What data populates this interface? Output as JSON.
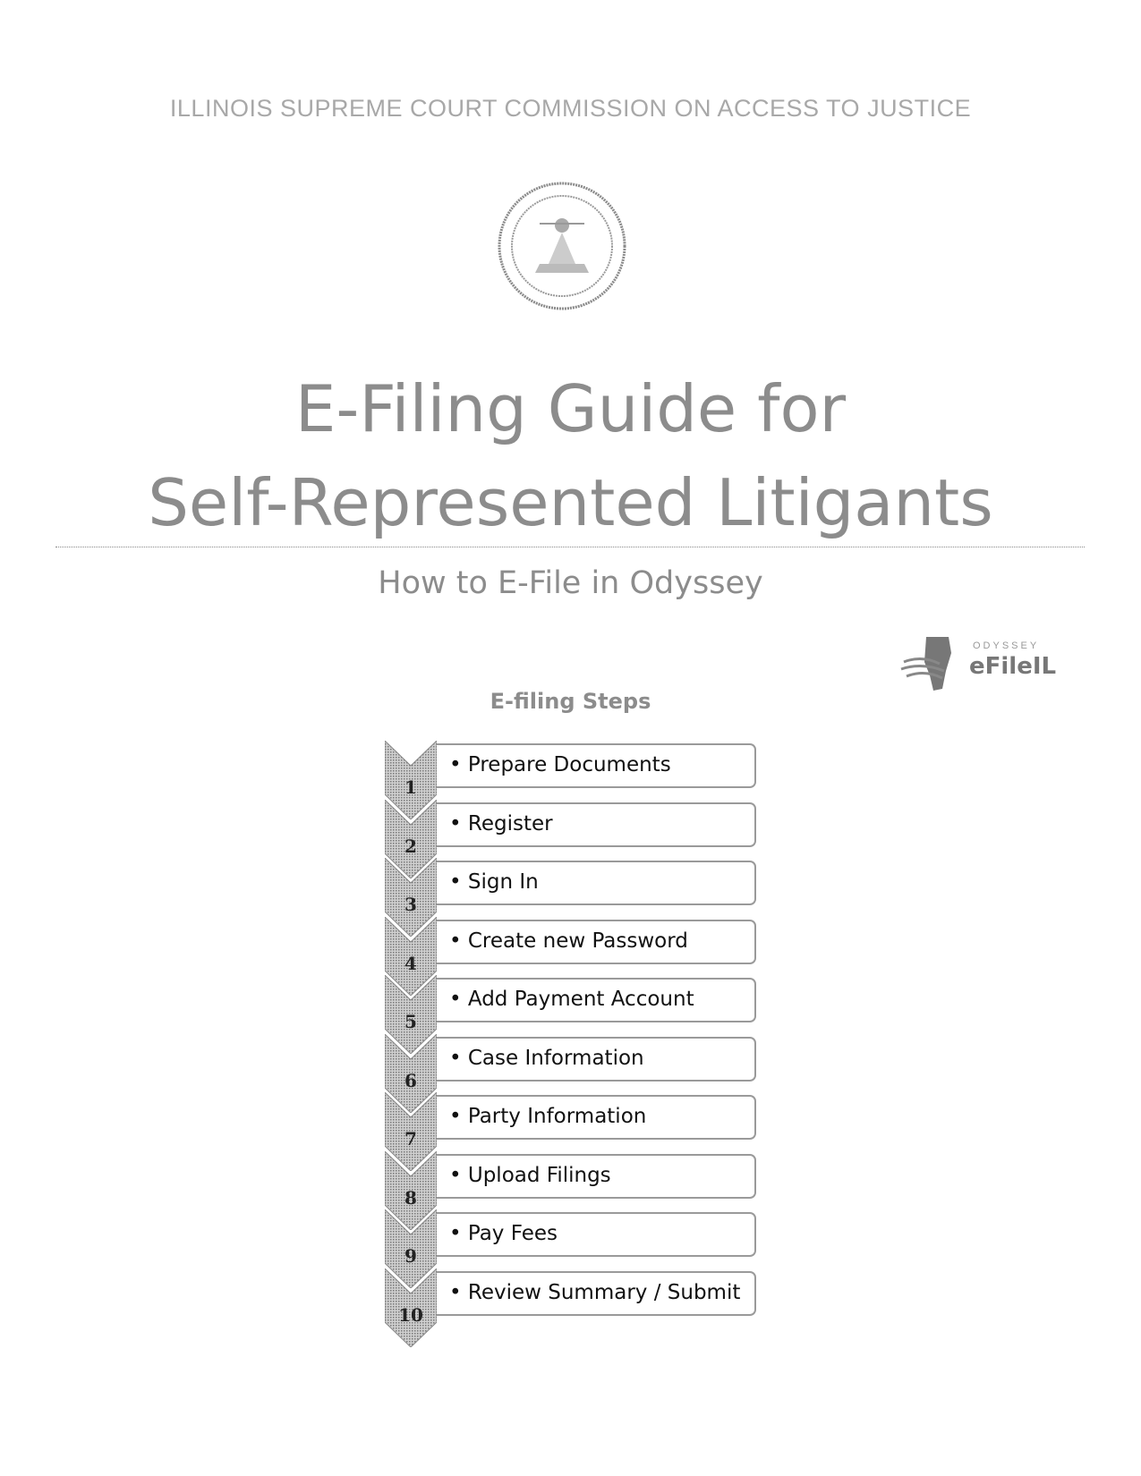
{
  "header": {
    "organization": "ILLINOIS SUPREME COURT COMMISSION ON ACCESS TO JUSTICE",
    "seal_icon": "supreme-court-seal"
  },
  "title": {
    "line1": "E-Filing Guide for",
    "line2": "Self-Represented Litigants",
    "subtitle": "How to E-File in Odyssey"
  },
  "logo": {
    "small_text": "ODYSSEY",
    "brand_text": "eFileIL"
  },
  "steps": {
    "heading": "E-filing Steps",
    "items": [
      {
        "number": "1",
        "label": "• Prepare Documents"
      },
      {
        "number": "2",
        "label": "• Register"
      },
      {
        "number": "3",
        "label": "• Sign In"
      },
      {
        "number": "4",
        "label": "• Create new Password"
      },
      {
        "number": "5",
        "label": "• Add Payment Account"
      },
      {
        "number": "6",
        "label": "• Case Information"
      },
      {
        "number": "7",
        "label": "• Party Information"
      },
      {
        "number": "8",
        "label": "• Upload Filings"
      },
      {
        "number": "9",
        "label": "• Pay Fees"
      },
      {
        "number": "10",
        "label": "• Review Summary / Submit"
      }
    ]
  }
}
